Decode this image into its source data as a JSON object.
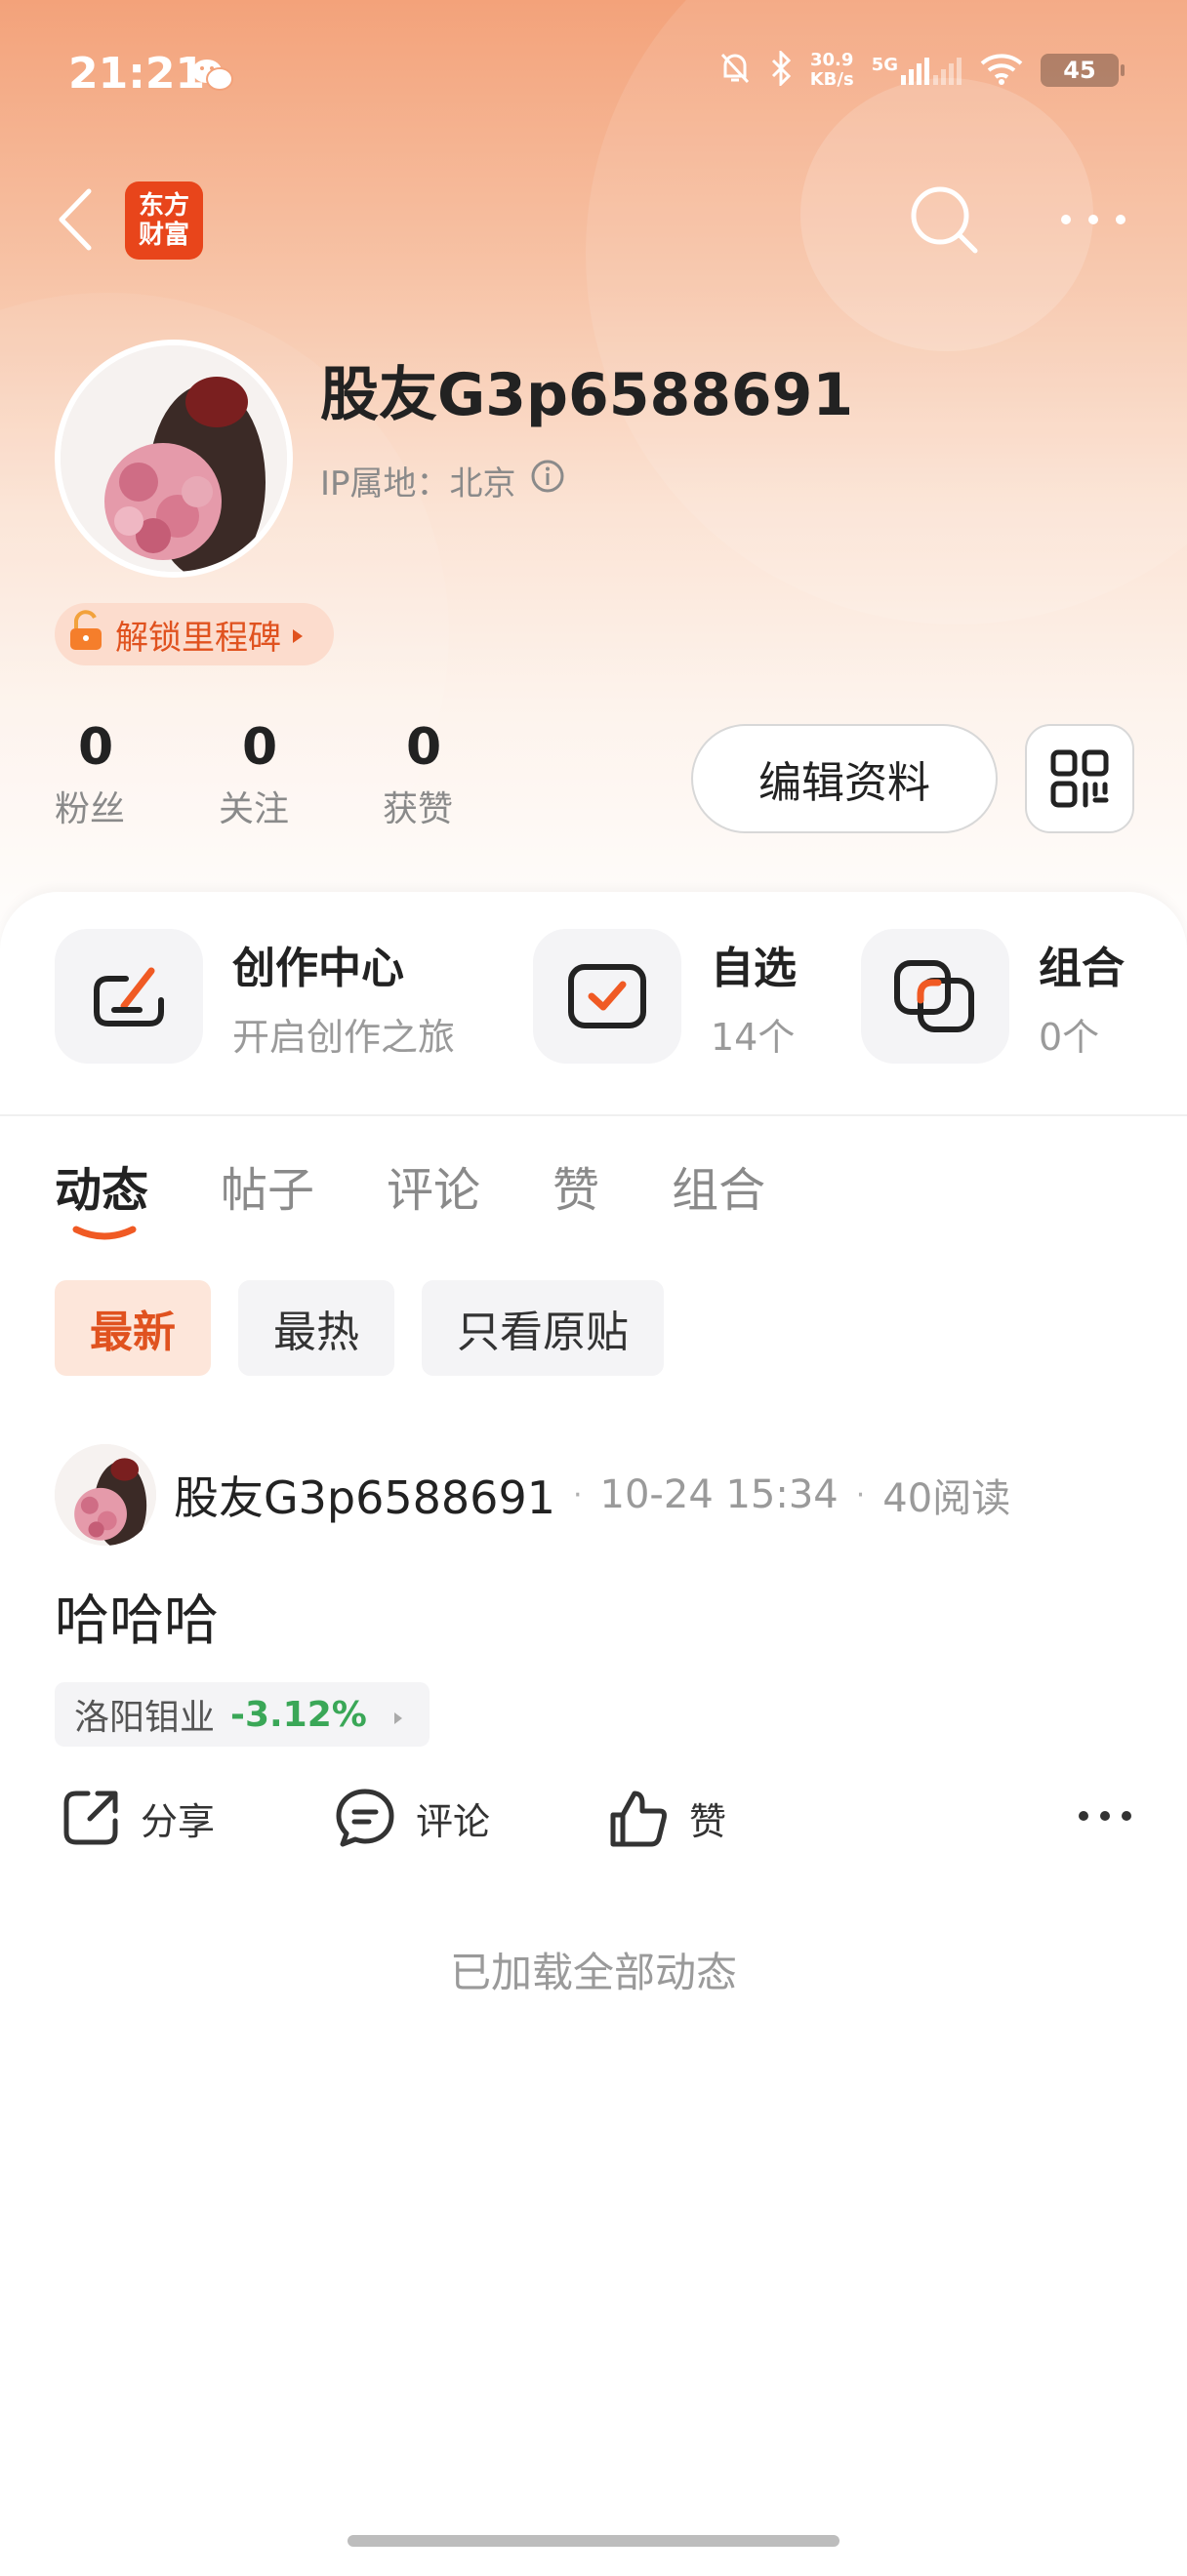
{
  "status_bar": {
    "time": "21:21",
    "net_speed_value": "30.9",
    "net_speed_unit": "KB/s",
    "network": "5G",
    "battery": "45"
  },
  "header": {
    "logo_line1": "东方",
    "logo_line2": "财富"
  },
  "profile": {
    "username": "股友G3p6588691",
    "ip_location": "IP属地：北京",
    "milestone": "解锁里程碑",
    "stats": [
      {
        "value": "0",
        "label": "粉丝"
      },
      {
        "value": "0",
        "label": "关注"
      },
      {
        "value": "0",
        "label": "获赞"
      }
    ],
    "edit_button": "编辑资料"
  },
  "entries": [
    {
      "title": "创作中心",
      "subtitle": "开启创作之旅",
      "icon": "edit-icon"
    },
    {
      "title": "自选",
      "subtitle": "14个",
      "icon": "check-box-icon"
    },
    {
      "title": "组合",
      "subtitle": "0个",
      "icon": "portfolio-icon"
    }
  ],
  "tabs": [
    "动态",
    "帖子",
    "评论",
    "赞",
    "组合"
  ],
  "filters": [
    "最新",
    "最热",
    "只看原贴"
  ],
  "post": {
    "username": "股友G3p6588691",
    "datetime": "10-24 15:34",
    "reads": "40阅读",
    "content": "哈哈哈",
    "stock_name": "洛阳钼业",
    "stock_change": "-3.12%",
    "actions": {
      "share": "分享",
      "comment": "评论",
      "like": "赞"
    }
  },
  "footer_text": "已加载全部动态",
  "colors": {
    "accent": "#e0521f",
    "stock_down": "#3aa757",
    "logo_red": "#e8451b"
  }
}
